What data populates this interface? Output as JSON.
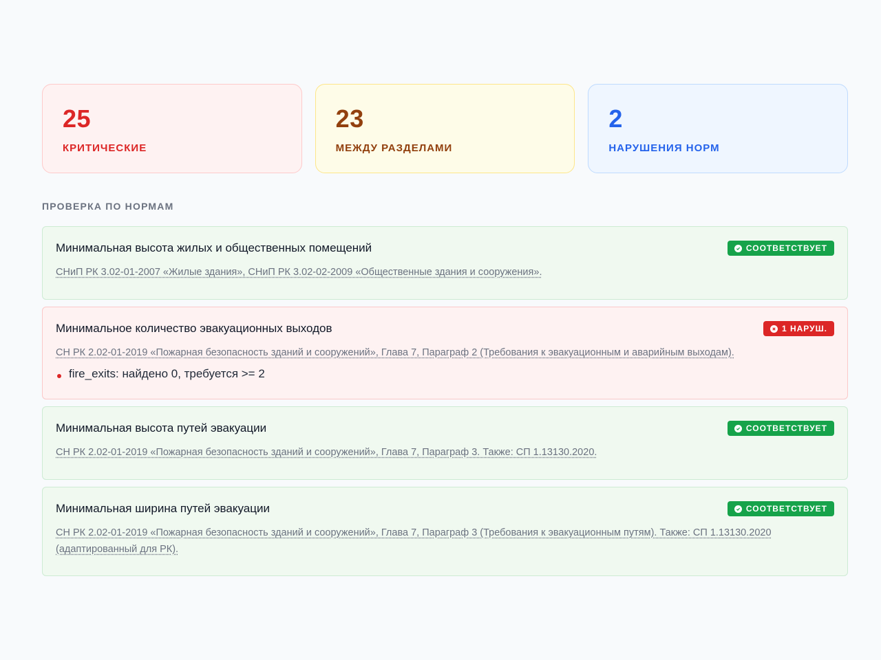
{
  "stats": [
    {
      "value": "25",
      "label": "КРИТИЧЕСКИЕ",
      "color": "#dc2626"
    },
    {
      "value": "23",
      "label": "МЕЖДУ РАЗДЕЛАМИ",
      "color": "#92400e"
    },
    {
      "value": "2",
      "label": "НАРУШЕНИЯ НОРМ",
      "color": "#2563eb"
    }
  ],
  "section_title": "ПРОВЕРКА ПО НОРМАМ",
  "checks": [
    {
      "title": "Минимальная высота жилых и общественных помещений",
      "reference": "СНиП РК 3.02-01-2007 «Жилые здания», СНиП РК 3.02-02-2009 «Общественные здания и сооружения».",
      "status": "СООТВЕТСТВУЕТ",
      "status_icon": "check-circle-icon",
      "status_color": "#16a34a"
    },
    {
      "title": "Минимальное количество эвакуационных выходов",
      "reference": "СН РК 2.02-01-2019 «Пожарная безопасность зданий и сооружений», Глава 7, Параграф 2 (Требования к эвакуационным и аварийным выходам).",
      "status": "1 НАРУШ.",
      "status_icon": "x-circle-icon",
      "status_color": "#dc2626",
      "issues": [
        "fire_exits: найдено 0, требуется >= 2"
      ]
    },
    {
      "title": "Минимальная высота путей эвакуации",
      "reference": "СН РК 2.02-01-2019 «Пожарная безопасность зданий и сооружений», Глава 7, Параграф 3. Также: СП 1.13130.2020.",
      "status": "СООТВЕТСТВУЕТ",
      "status_icon": "check-circle-icon",
      "status_color": "#16a34a"
    },
    {
      "title": "Минимальная ширина путей эвакуации",
      "reference": "СН РК 2.02-01-2019 «Пожарная безопасность зданий и сооружений», Глава 7, Параграф 3 (Требования к эвакуационным путям). Также: СП 1.13130.2020 (адаптированный для РК).",
      "status": "СООТВЕТСТВУЕТ",
      "status_icon": "check-circle-icon",
      "status_color": "#16a34a"
    }
  ]
}
